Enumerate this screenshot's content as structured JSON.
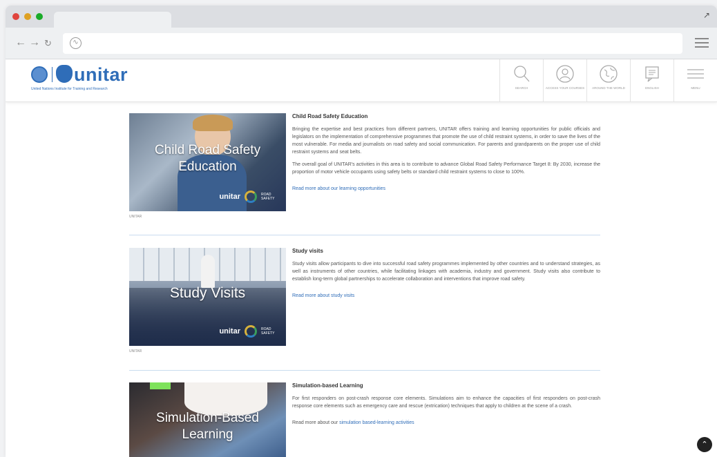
{
  "browser": {
    "dots": [
      "#e0443e",
      "#dea123",
      "#1aab29"
    ]
  },
  "logo": {
    "wordmark": "unitar",
    "tagline": "United Nations Institute for Training and Research"
  },
  "header_icons": [
    {
      "name": "search-icon",
      "label": "SEARCH"
    },
    {
      "name": "user-icon",
      "label": "ACCESS YOUR COURSES"
    },
    {
      "name": "globe-icon",
      "label": "AROUND THE WORLD"
    },
    {
      "name": "language-icon",
      "label": "ENGLISH"
    },
    {
      "name": "menu-icon",
      "label": "MENU"
    }
  ],
  "items": [
    {
      "image_caption": "Child Road Safety Education",
      "credit": "UNITAR",
      "badge_wordmark": "unitar",
      "badge_text": "ROAD SAFETY",
      "title": "Child Road Safety Education",
      "paragraphs": [
        "Bringing the expertise and best practices from different partners, UNITAR offers training and learning opportunities for public officials and legislators on the implementation of comprehensive programmes that promote the use of child restraint systems, in order to save the lives of the most vulnerable.  For media and journalists on road safety and social communication. For parents and grandparents on the proper use of child restraint systems and seat belts.",
        "The overall goal of UNITAR's activities in this area is to contribute to advance Global Road Safety Performance Target 8: By 2030, increase the proportion of motor vehicle occupants using safety belts or standard child restraint systems to close to 100%."
      ],
      "link": "Read more about our learning opportunities"
    },
    {
      "image_caption": "Study Visits",
      "credit": "UNITAR",
      "badge_wordmark": "unitar",
      "badge_text": "ROAD SAFETY",
      "title": "Study visits",
      "paragraphs": [
        "Study visits allow participants to dive into successful road safety programmes implemented by other countries and to understand strategies, as well as instruments of other countries, while facilitating linkages with academia, industry and government. Study visits also contribute to establish long-term global partnerships to accelerate collaboration and interventions that improve road safety."
      ],
      "link": "Read more about study visits"
    },
    {
      "image_caption": "Simulation-Based Learning",
      "title": "Simulation-based Learning",
      "paragraphs": [
        "For first responders on post-crash response core elements. Simulations aim to enhance the capacities of first responders on post-crash response core elements such as emergency care and rescue (extrication) techniques that apply to children at the scene of a crash."
      ],
      "link_prefix": "Read more about our ",
      "link": "simulation based-learning activities"
    }
  ]
}
